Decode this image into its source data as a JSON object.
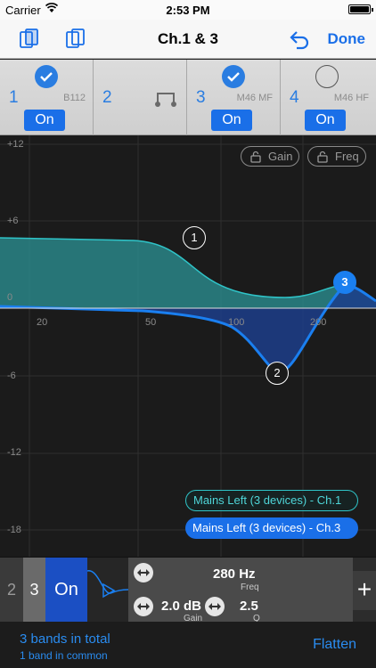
{
  "status": {
    "carrier": "Carrier",
    "time": "2:53 PM"
  },
  "nav": {
    "title": "Ch.1 & 3",
    "done_label": "Done"
  },
  "channels": [
    {
      "number": "1",
      "device": "B112",
      "checked": true,
      "on_label": "On"
    },
    {
      "number": "2",
      "device": "",
      "checked": false,
      "on_label": ""
    },
    {
      "number": "3",
      "device": "M46 MF",
      "checked": true,
      "on_label": "On"
    },
    {
      "number": "4",
      "device": "M46 HF",
      "checked": false,
      "on_label": "On"
    }
  ],
  "graph": {
    "y_labels": [
      "+12",
      "+6",
      "0",
      "-6",
      "-12",
      "-18"
    ],
    "x_labels": [
      "20",
      "50",
      "100",
      "200"
    ],
    "gain_lock": "Gain",
    "freq_lock": "Freq",
    "nodes": [
      "1",
      "2",
      "3"
    ],
    "legend": [
      "Mains Left (3 devices) - Ch.1",
      "Mains Left (3 devices) - Ch.3"
    ],
    "colors": {
      "teal": "#2fc4c8",
      "blue": "#1a7ff0"
    }
  },
  "controls": {
    "tab_2": "2",
    "tab_3": "3",
    "on_label": "On",
    "freq_value": "280 Hz",
    "freq_label": "Freq",
    "gain_value": "2.0 dB",
    "gain_label": "Gain",
    "q_value": "2.5",
    "q_label": "Q",
    "add_label": "+"
  },
  "footer": {
    "bands_total": "3 bands in total",
    "bands_common": "1 band in common",
    "flatten_label": "Flatten"
  }
}
